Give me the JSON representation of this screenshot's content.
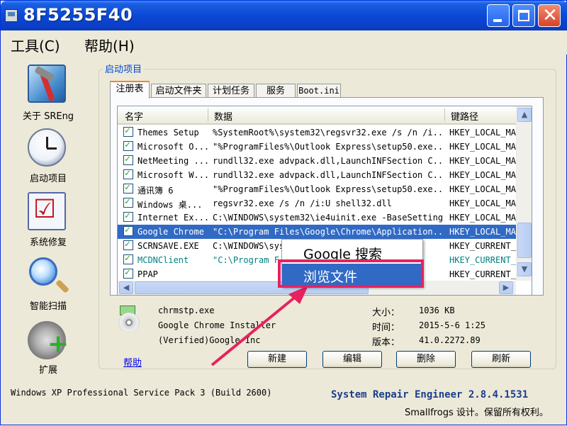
{
  "window": {
    "title": "8F5255F40"
  },
  "menu": {
    "tools": "工具(C)",
    "help": "帮助(H)"
  },
  "sidebar": {
    "items": [
      {
        "label": "关于 SREng",
        "icon": "tools-icon"
      },
      {
        "label": "启动项目",
        "icon": "clock-icon"
      },
      {
        "label": "系统修复",
        "icon": "checklist-icon"
      },
      {
        "label": "智能扫描",
        "icon": "magnifier-icon"
      },
      {
        "label": "扩展",
        "icon": "gear-plus-icon"
      }
    ]
  },
  "group": {
    "title": "启动项目"
  },
  "tabs": [
    "注册表",
    "启动文件夹",
    "计划任务",
    "服务",
    "Boot.ini"
  ],
  "listview": {
    "columns": [
      "名字",
      "数据",
      "键路径"
    ],
    "rows": [
      {
        "name": "Themes Setup",
        "data": "%SystemRoot%\\system32\\regsvr32.exe /s /n /i...",
        "key": "HKEY_LOCAL_MA",
        "checked": true
      },
      {
        "name": "Microsoft O...",
        "data": "\"%ProgramFiles%\\Outlook Express\\setup50.exe...",
        "key": "HKEY_LOCAL_MA",
        "checked": true
      },
      {
        "name": "NetMeeting ...",
        "data": "rundll32.exe advpack.dll,LaunchINFSection C...",
        "key": "HKEY_LOCAL_MA",
        "checked": true
      },
      {
        "name": "Microsoft W...",
        "data": "rundll32.exe advpack.dll,LaunchINFSection C...",
        "key": "HKEY_LOCAL_MA",
        "checked": true
      },
      {
        "name": "通讯簿 6",
        "data": "\"%ProgramFiles%\\Outlook Express\\setup50.exe...",
        "key": "HKEY_LOCAL_MA",
        "checked": true
      },
      {
        "name": "Windows 桌...",
        "data": "regsvr32.exe /s /n /i:U shell32.dll",
        "key": "HKEY_LOCAL_MA",
        "checked": true
      },
      {
        "name": "Internet Ex...",
        "data": "C:\\WINDOWS\\system32\\ie4uinit.exe -BaseSettings",
        "key": "HKEY_LOCAL_MA",
        "checked": true
      },
      {
        "name": "Google Chrome",
        "data": "\"C:\\Program Files\\Google\\Chrome\\Application...",
        "key": "HKEY_LOCAL_MA",
        "checked": true,
        "selected": true
      },
      {
        "name": "SCRNSAVE.EXE",
        "data": "C:\\WINDOWS\\sys",
        "key": "HKEY_CURRENT_",
        "checked": true
      },
      {
        "name": "MCDNClient",
        "data": "\"C:\\Program F",
        "key": "HKEY_CURRENT_",
        "checked": true,
        "teal": true
      },
      {
        "name": "PPAP",
        "data": "",
        "key": "HKEY_CURRENT_",
        "checked": true
      }
    ]
  },
  "context_menu": {
    "items": [
      "Google 搜索",
      "浏览文件"
    ],
    "highlighted_index": 1
  },
  "details": {
    "filename": "chrmstp.exe",
    "product": "Google Chrome Installer",
    "company": "(Verified)Google Inc",
    "size_label": "大小：",
    "size_value": "1036 KB",
    "time_label": "时间：",
    "time_value": "2015-5-6 1:25",
    "version_label": "版本：",
    "version_value": "41.0.2272.89"
  },
  "buttons": {
    "help": "帮助",
    "new": "新建",
    "edit": "编辑",
    "delete": "删除",
    "refresh": "刷新"
  },
  "status": {
    "os": "Windows XP Professional Service Pack 3 (Build 2600)",
    "product": "System Repair Engineer 2.8.4.1531",
    "copyright": "Smallfrogs 设计。保留所有权利。"
  },
  "colors": {
    "title_bar": "#0a49d6",
    "selection": "#316ac5",
    "highlight_box": "#e8215f",
    "annotation_arrow": "#e8215f"
  }
}
